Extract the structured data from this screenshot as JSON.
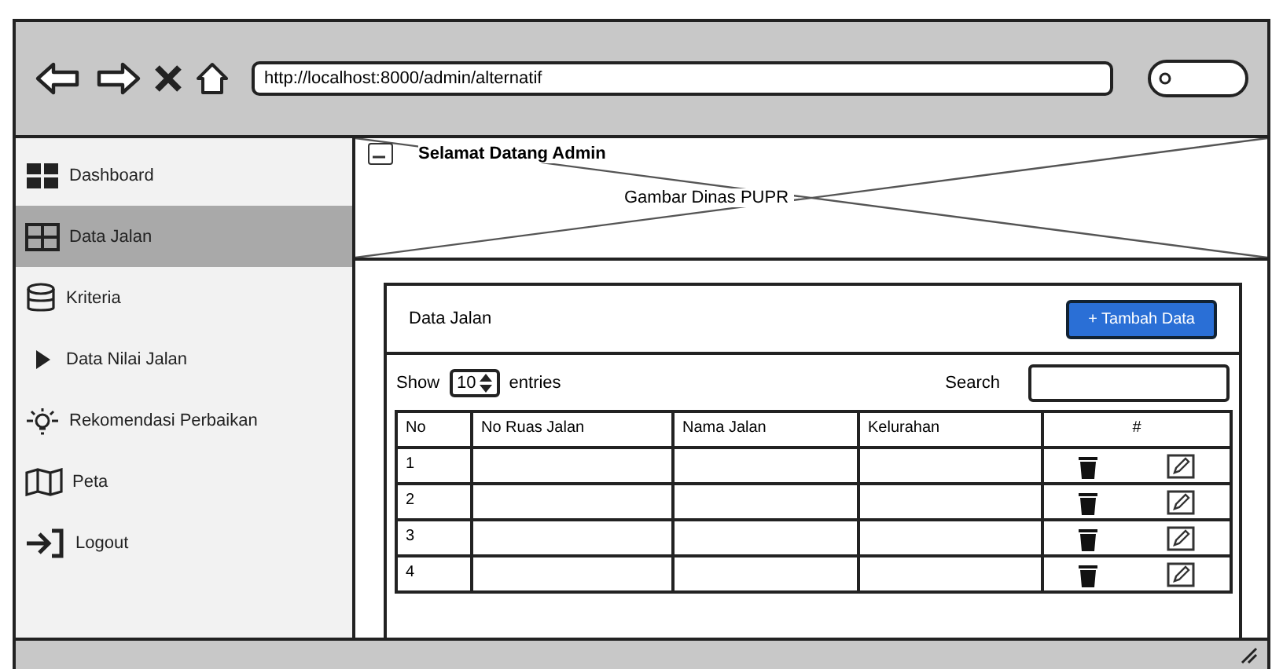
{
  "browser": {
    "url": "http://localhost:8000/admin/alternatif"
  },
  "sidebar": {
    "items": [
      {
        "label": "Dashboard",
        "selected": false
      },
      {
        "label": "Data Jalan",
        "selected": true
      },
      {
        "label": "Kriteria",
        "selected": false
      },
      {
        "label": "Data Nilai Jalan",
        "selected": false
      },
      {
        "label": "Rekomendasi Perbaikan",
        "selected": false
      },
      {
        "label": "Peta",
        "selected": false
      },
      {
        "label": "Logout",
        "selected": false
      }
    ]
  },
  "header": {
    "greeting": "Selamat Datang Admin",
    "image_label": "Gambar Dinas PUPR"
  },
  "panel": {
    "title": "Data Jalan",
    "add_button": "+ Tambah Data",
    "show_label": "Show",
    "page_size": "10",
    "entries_label": "entries",
    "search_label": "Search",
    "columns": [
      "No",
      "No Ruas Jalan",
      "Nama Jalan",
      "Kelurahan",
      "#"
    ],
    "rows": [
      {
        "no": "1"
      },
      {
        "no": "2"
      },
      {
        "no": "3"
      },
      {
        "no": "4"
      }
    ]
  }
}
